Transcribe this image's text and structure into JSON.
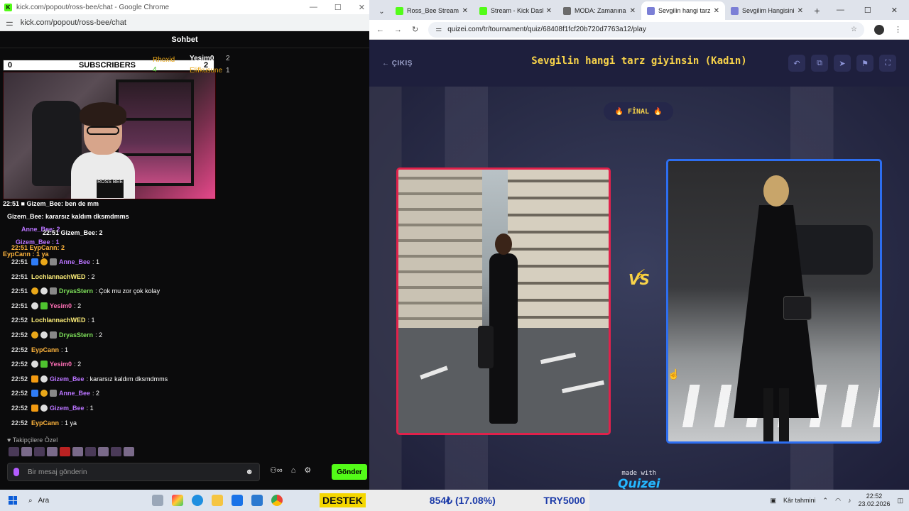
{
  "left_window": {
    "title": "kick.com/popout/ross-bee/chat - Google Chrome",
    "url": "kick.com/popout/ross-bee/chat",
    "chat_header": "Sohbet",
    "subs_overlay": {
      "left_count": "0",
      "label": "SUBSCRIBERS",
      "right_count": "2"
    },
    "top_gifters": [
      {
        "name": "Rhoxid",
        "count": "4"
      },
      {
        "name": "Yesim0",
        "count": "2"
      },
      {
        "name": "Elifkusune",
        "count": "1"
      }
    ],
    "clapper_text": "ROSS BEE",
    "ghost_lines": [
      "22:51 ■ Gizem_Bee: ben de mm",
      "Gizem_Bee: kararsız kaldım dksmdmms",
      "Anne_Bee: 2",
      "22:51 Gizem_Bee: 2",
      "Gizem_Bee : 1",
      "22:51 EypCann: 2",
      "EypCann : 1 ya"
    ],
    "messages": [
      {
        "time": "22:51",
        "badges": [
          "blue",
          "gold",
          "grey"
        ],
        "user": "Anne_Bee",
        "ucls": "u-purple",
        "text": ": 1"
      },
      {
        "time": "22:51",
        "badges": [],
        "user": "LochlannachWED",
        "ucls": "u-yellow",
        "text": ": 2"
      },
      {
        "time": "22:51",
        "badges": [
          "gold",
          "white",
          "grey"
        ],
        "user": "DryasStern",
        "ucls": "u-green",
        "text": ": Çok mu zor çok kolay"
      },
      {
        "time": "22:51",
        "badges": [
          "white",
          "green"
        ],
        "user": "Yesim0",
        "ucls": "u-pink",
        "text": ": 2"
      },
      {
        "time": "22:52",
        "badges": [],
        "user": "LochlannachWED",
        "ucls": "u-yellow",
        "text": ": 1"
      },
      {
        "time": "22:52",
        "badges": [
          "gold",
          "white",
          "grey"
        ],
        "user": "DryasStern",
        "ucls": "u-green",
        "text": ": 2"
      },
      {
        "time": "22:52",
        "badges": [],
        "user": "EypCann",
        "ucls": "u-orange",
        "text": ": 1"
      },
      {
        "time": "22:52",
        "badges": [
          "white",
          "green"
        ],
        "user": "Yesim0",
        "ucls": "u-pink",
        "text": ": 2"
      },
      {
        "time": "22:52",
        "badges": [
          "orange",
          "white"
        ],
        "user": "Gizem_Bee",
        "ucls": "u-purple",
        "text": ": kararsız kaldım dksmdmms"
      },
      {
        "time": "22:52",
        "badges": [
          "blue",
          "gold",
          "grey"
        ],
        "user": "Anne_Bee",
        "ucls": "u-purple",
        "text": ": 2"
      },
      {
        "time": "22:52",
        "badges": [
          "orange",
          "white"
        ],
        "user": "Gizem_Bee",
        "ucls": "u-purple",
        "text": ": 1"
      },
      {
        "time": "22:52",
        "badges": [],
        "user": "EypCann",
        "ucls": "u-orange",
        "text": ": 1 ya"
      }
    ],
    "followers_label": "Takipçilere Özel",
    "input_placeholder": "Bir mesaj gönderin",
    "send_label": "Gönder"
  },
  "right_window": {
    "tabs": [
      {
        "label": "Ross_Bee Stream - \\",
        "fav": "#53fc18"
      },
      {
        "label": "Stream - Kick Dashb",
        "fav": "#53fc18"
      },
      {
        "label": "MODA: Zamanına D",
        "fav": "#6b6b6b"
      },
      {
        "label": "Sevgilin hangi tarz g",
        "fav": "#7b7fd6",
        "active": true
      },
      {
        "label": "Sevgilim Hangisini",
        "fav": "#7b7fd6"
      }
    ],
    "url": "quizei.com/tr/tournament/quiz/68408f1fcf20b720d7763a12/play",
    "quiz": {
      "exit_label": "← ÇIKIŞ",
      "title": "Sevgilin hangi tarz giyinsin (Kadın)",
      "round_badge": "FİNAL",
      "vs": "VS",
      "made_with": "made with",
      "logo": "Quizei"
    }
  },
  "taskbar": {
    "search": "Ara",
    "ticker": {
      "tag": "DESTEK",
      "value": "854₺ (17.08%)",
      "goal": "TRY5000"
    },
    "weather": "Kâr tahmini",
    "time": "22:52",
    "date": "23.02.2026"
  }
}
